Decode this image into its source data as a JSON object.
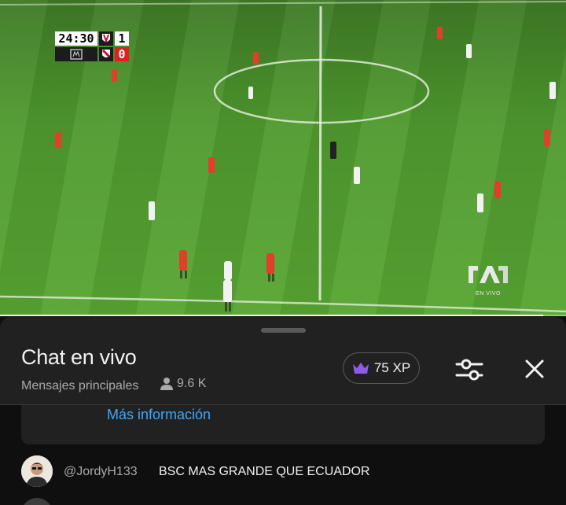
{
  "video": {
    "scorebug": {
      "time": "24:30",
      "home_score": "1",
      "away_score": "0"
    },
    "channel_logo_text": "EN VIVO",
    "progress_fraction": 0.96
  },
  "chat": {
    "title": "Chat en vivo",
    "subtitle": "Mensajes principales",
    "viewer_count": "9.6 K",
    "xp_label": "75 XP",
    "more_info": "Más información",
    "messages": [
      {
        "user": "@JordyH133",
        "text": "BSC MAS GRANDE QUE ECUADOR"
      }
    ]
  },
  "icons": {
    "viewers": "person-icon",
    "xp": "crown-icon",
    "filter": "sliders-icon",
    "close": "close-icon"
  },
  "colors": {
    "link": "#3ea6ff",
    "crown": "#8c5ce6",
    "pitch": "#4f9a2e"
  }
}
